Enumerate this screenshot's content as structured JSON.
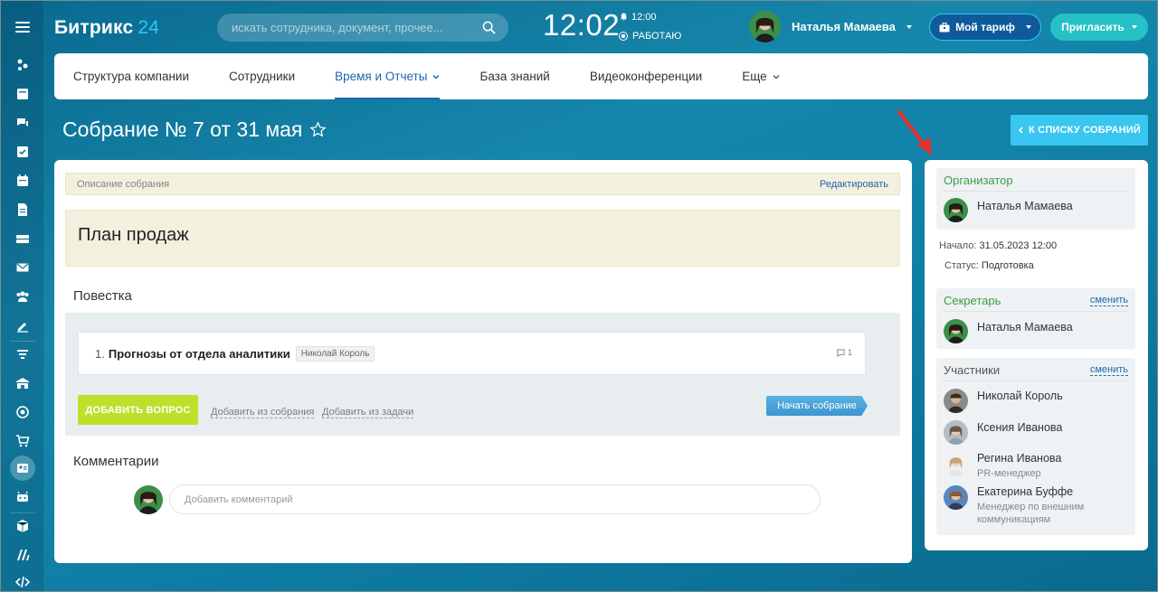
{
  "app": {
    "logo_text": "Битрикс",
    "logo_num": "24"
  },
  "header": {
    "search_placeholder": "искать сотрудника, документ, прочее...",
    "time": "12:02",
    "alarm_time": "12:00",
    "work_status": "РАБОТАЮ",
    "user_name": "Наталья Мамаева",
    "tariff_label": "Мой тариф",
    "invite_label": "Пригласить"
  },
  "nav": {
    "items": [
      {
        "label": "Структура компании"
      },
      {
        "label": "Сотрудники"
      },
      {
        "label": "Время и Отчеты"
      },
      {
        "label": "База знаний"
      },
      {
        "label": "Видеоконференции"
      },
      {
        "label": "Еще"
      }
    ]
  },
  "page": {
    "title": "Собрание № 7 от 31 мая",
    "back_label": "К СПИСКУ СОБРАНИЙ"
  },
  "description": {
    "header_label": "Описание собрания",
    "edit_label": "Редактировать",
    "text": "План продаж"
  },
  "agenda": {
    "heading": "Повестка",
    "items": [
      {
        "number": "1.",
        "title": "Прогнозы от отдела аналитики",
        "responsible": "Николай Король",
        "comments": "1"
      }
    ],
    "add_question_label": "ДОБАВИТЬ ВОПРОС",
    "add_from_meeting_label": "Добавить из собрания",
    "add_from_task_label": "Добавить из задачи",
    "start_meeting_label": "Начать собрание"
  },
  "comments": {
    "heading": "Комментарии",
    "placeholder": "Добавить комментарий"
  },
  "sidebar_right": {
    "organizer": {
      "heading": "Организатор",
      "name": "Наталья Мамаева"
    },
    "start_label": "Начало:",
    "start_value": "31.05.2023 12:00",
    "status_label": "Статус:",
    "status_value": "Подготовка",
    "secretary": {
      "heading": "Секретарь",
      "change_label": "сменить",
      "name": "Наталья Мамаева"
    },
    "participants": {
      "heading": "Участники",
      "change_label": "сменить",
      "people": [
        {
          "name": "Николай Король",
          "role": ""
        },
        {
          "name": "Ксения Иванова",
          "role": ""
        },
        {
          "name": "Регина Иванова",
          "role": "PR-менеджер"
        },
        {
          "name": "Екатерина Буффе",
          "role": "Менеджер по внешним коммуникациям"
        }
      ]
    }
  },
  "colors": {
    "accent_green": "#bbe12a",
    "accent_blue": "#2067b0",
    "heading_green": "#3f9e45",
    "annotation_red": "#e8302a"
  }
}
